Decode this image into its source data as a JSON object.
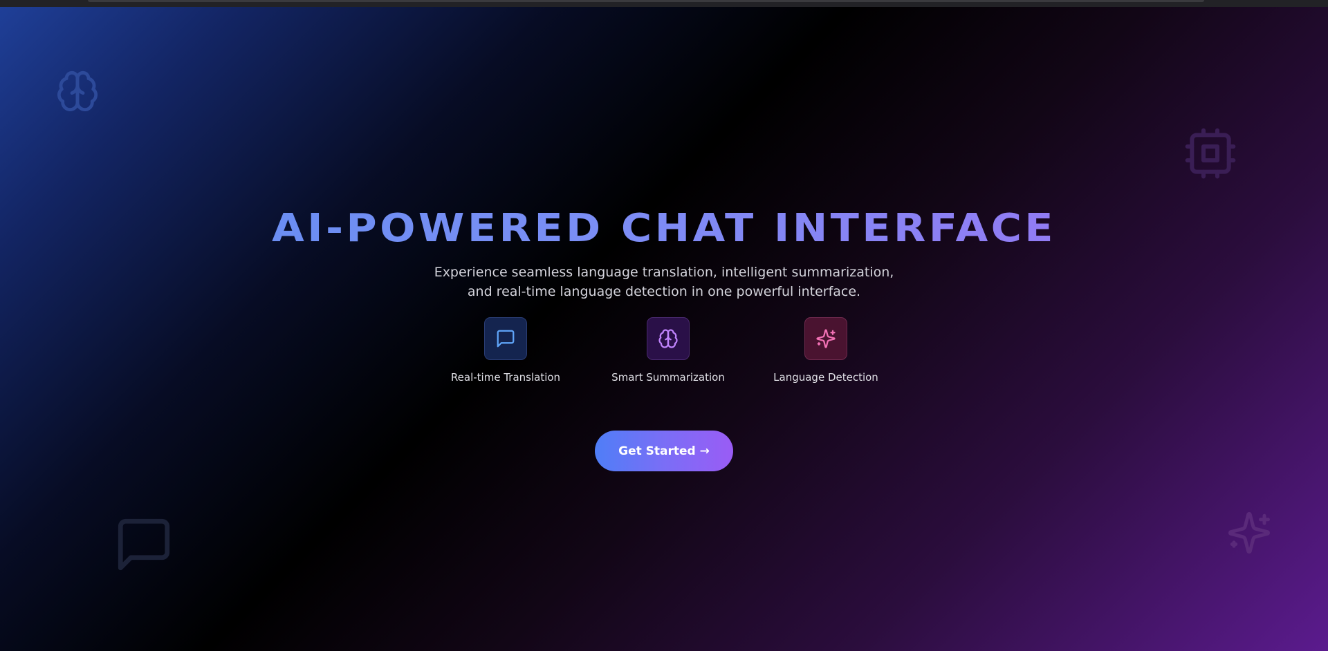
{
  "hero": {
    "title": "AI-Powered Chat Interface",
    "subtitle_line1": "Experience seamless language translation, intelligent summarization,",
    "subtitle_line2": "and real-time language detection in one powerful interface."
  },
  "features": [
    {
      "label": "Real-time Translation",
      "icon": "message-square-icon",
      "color": "#60a5fa"
    },
    {
      "label": "Smart Summarization",
      "icon": "brain-icon",
      "color": "#c084fc"
    },
    {
      "label": "Language Detection",
      "icon": "sparkles-icon",
      "color": "#f472b6"
    }
  ],
  "cta": {
    "label": "Get Started →"
  },
  "background_icons": [
    "brain-icon",
    "cpu-icon",
    "message-square-icon",
    "sparkles-icon"
  ],
  "colors": {
    "accent_blue": "#4f7ef7",
    "accent_purple": "#9a5cf5"
  }
}
